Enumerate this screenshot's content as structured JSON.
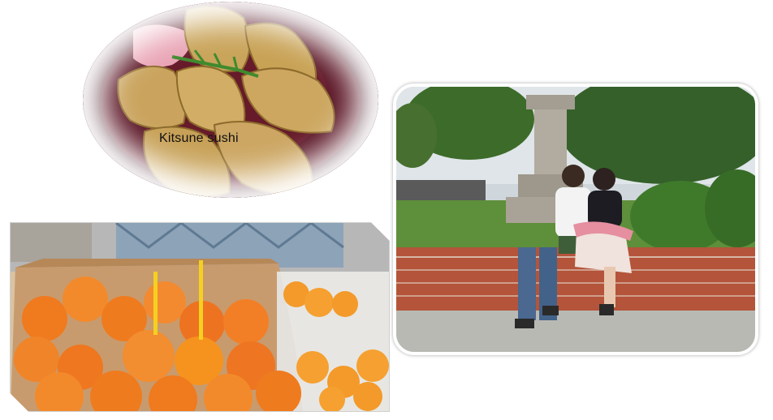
{
  "photos": {
    "sushi": {
      "caption": "Kitsune sushi"
    },
    "oranges": {
      "caption": ""
    },
    "park": {
      "caption": ""
    }
  },
  "colors": {
    "tray": "#4b1020",
    "tofu_pouch": "#c9a45a",
    "orange": "#f07a1e",
    "brick": "#b4543a",
    "grass": "#5e8f3a",
    "background": "#ffffff"
  }
}
